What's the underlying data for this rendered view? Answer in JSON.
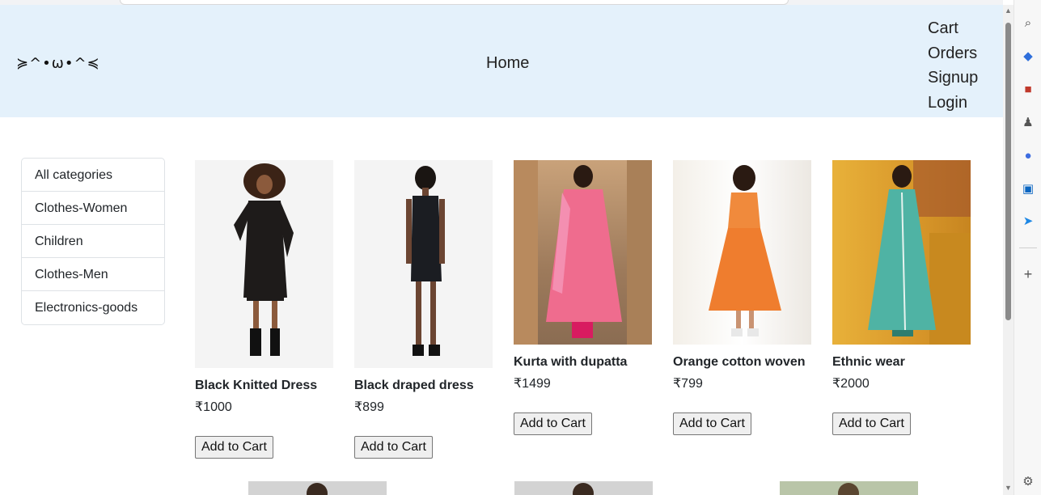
{
  "nav": {
    "brand": "≽^•ω•^≼",
    "home": "Home",
    "links": [
      "Cart",
      "Orders",
      "Signup",
      "Login"
    ]
  },
  "categories": [
    "All categories",
    "Clothes-Women",
    "Children",
    "Clothes-Men",
    "Electronics-goods"
  ],
  "products": [
    {
      "name": "Black Knitted Dress",
      "price": "₹1000",
      "button": "Add to Cart"
    },
    {
      "name": "Black draped dress",
      "price": "₹899",
      "button": "Add to Cart"
    },
    {
      "name": "Kurta with dupatta",
      "price": "₹1499",
      "button": "Add to Cart"
    },
    {
      "name": "Orange cotton woven",
      "price": "₹799",
      "button": "Add to Cart"
    },
    {
      "name": "Ethnic wear",
      "price": "₹2000",
      "button": "Add to Cart"
    }
  ],
  "rail_icons": [
    "search-icon",
    "tag-icon",
    "briefcase-icon",
    "chess-icon",
    "copilot-icon",
    "outlook-icon",
    "send-icon",
    "plus-icon",
    "settings-icon"
  ],
  "colors": {
    "navbar": "#e4f1fb",
    "border": "#dee2e6"
  }
}
